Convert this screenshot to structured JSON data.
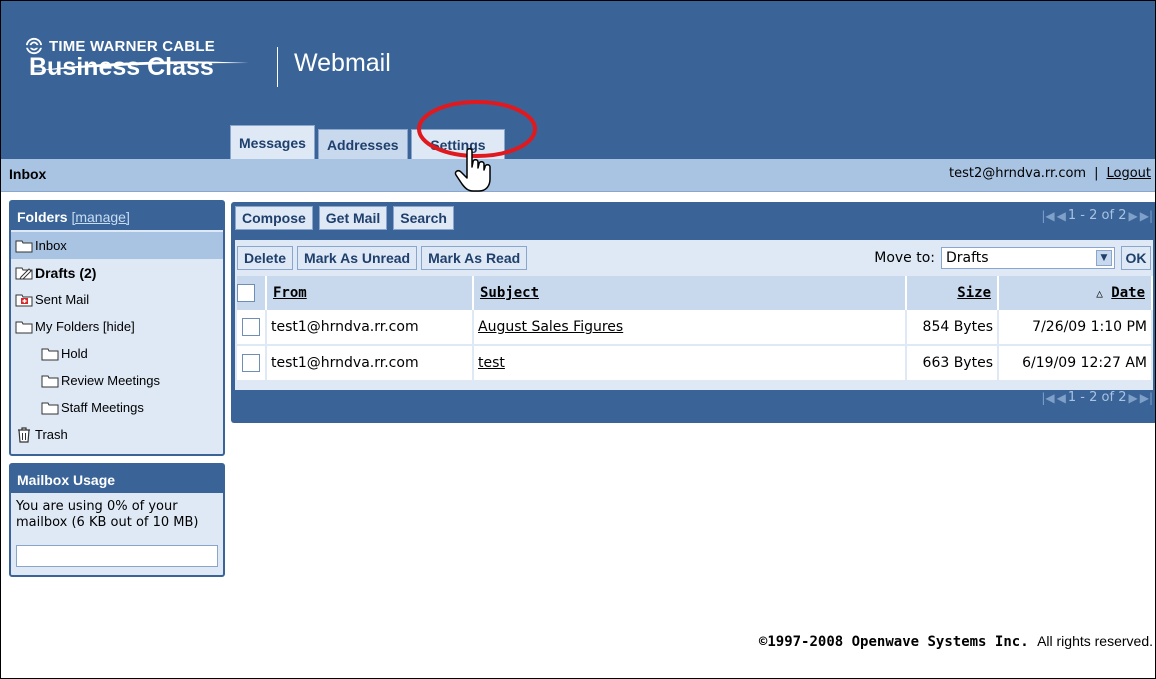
{
  "brand": {
    "company_line": "TIME WARNER CABLE",
    "product_line": "Business Class",
    "app_title": "Webmail"
  },
  "tabs": [
    {
      "label": "Messages"
    },
    {
      "label": "Addresses"
    },
    {
      "label": "Settings"
    }
  ],
  "status": {
    "folder_title": "Inbox",
    "user_email": "test2@hrndva.rr.com",
    "separator": "|",
    "logout": "Logout"
  },
  "folders_panel": {
    "title": "Folders",
    "manage": "[manage]",
    "items": [
      {
        "label": "Inbox",
        "icon": "folder-icon"
      },
      {
        "label": "Drafts (2)",
        "icon": "drafts-folder-icon"
      },
      {
        "label": "Sent Mail",
        "icon": "sent-folder-icon"
      },
      {
        "label": "My Folders",
        "hide": "[hide]",
        "icon": "folder-icon"
      },
      {
        "label": "Hold",
        "icon": "folder-icon"
      },
      {
        "label": "Review Meetings",
        "icon": "folder-icon"
      },
      {
        "label": "Staff Meetings",
        "icon": "folder-icon"
      },
      {
        "label": "Trash",
        "icon": "trash-icon"
      }
    ]
  },
  "usage_panel": {
    "title": "Mailbox Usage",
    "text": "You are using 0% of your mailbox (6 KB out of 10 MB)",
    "usage_fraction": 0
  },
  "toolbar": {
    "compose": "Compose",
    "get_mail": "Get Mail",
    "search": "Search",
    "delete": "Delete",
    "mark_unread": "Mark As Unread",
    "mark_read": "Mark As Read",
    "move_to_label": "Move to:",
    "move_to_value": "Drafts",
    "ok": "OK"
  },
  "pager": {
    "range": "1 - 2 of 2"
  },
  "table": {
    "headers": {
      "from": "From",
      "subject": "Subject",
      "size": "Size",
      "date": "Date"
    },
    "rows": [
      {
        "from": "test1@hrndva.rr.com",
        "subject": "August Sales Figures",
        "size": "854 Bytes",
        "date": "7/26/09 1:10 PM"
      },
      {
        "from": "test1@hrndva.rr.com",
        "subject": "test",
        "size": "663 Bytes",
        "date": "6/19/09 12:27 AM"
      }
    ]
  },
  "footer": {
    "copyright": "©1997-2008 Openwave Systems Inc.",
    "rights": "All rights reserved."
  },
  "colors": {
    "header_blue": "#3a6497",
    "light_blue": "#dfe9f6",
    "mid_blue": "#a9c3e2",
    "highlight_red": "#e0191f"
  }
}
